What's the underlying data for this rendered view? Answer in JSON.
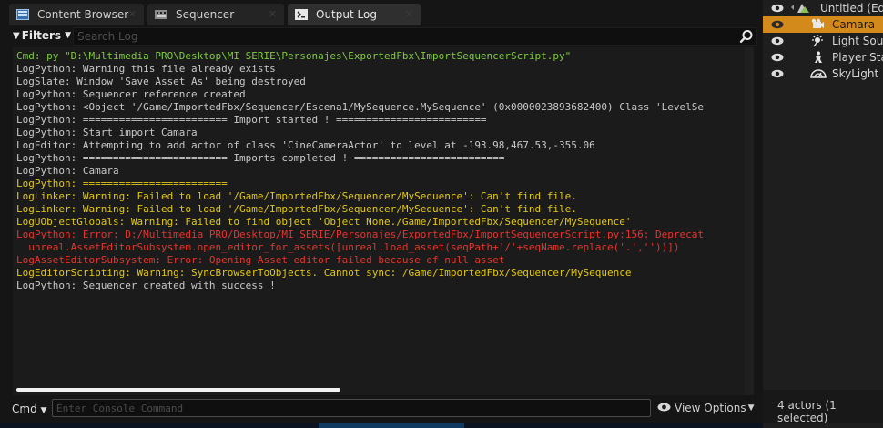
{
  "tabs": [
    {
      "label": "Content Browser",
      "icon": "content-browser-icon",
      "active": false
    },
    {
      "label": "Sequencer",
      "icon": "sequencer-icon",
      "active": false
    },
    {
      "label": "Output Log",
      "icon": "output-log-icon",
      "active": true
    }
  ],
  "toolbar": {
    "filters_label": "Filters",
    "search_placeholder": "Search Log"
  },
  "log_lines": [
    {
      "text": "Cmd: py \"D:\\Multimedia PRO\\Desktop\\MI SERIE\\Personajes\\ExportedFbx\\ImportSequencerScript.py\"",
      "level": "green"
    },
    {
      "text": "LogPython: Warning this file already exists",
      "level": "white"
    },
    {
      "text": "LogSlate: Window 'Save Asset As' being destroyed",
      "level": "white"
    },
    {
      "text": "LogPython: Sequencer reference created",
      "level": "white"
    },
    {
      "text": "LogPython: <Object '/Game/ImportedFbx/Sequencer/Escena1/MySequence.MySequence' (0x0000023893682400) Class 'LevelSe",
      "level": "white"
    },
    {
      "text": "LogPython: ======================== Import started ! =========================",
      "level": "white"
    },
    {
      "text": "LogPython: Start import Camara",
      "level": "white"
    },
    {
      "text": "LogEditor: Attempting to add actor of class 'CineCameraActor' to level at -193.98,467.53,-355.06",
      "level": "white"
    },
    {
      "text": "LogPython: ======================== Imports completed ! =========================",
      "level": "white"
    },
    {
      "text": "LogPython: Camara",
      "level": "white"
    },
    {
      "text": "LogPython: ========================",
      "level": "yellow"
    },
    {
      "text": "LogLinker: Warning: Failed to load '/Game/ImportedFbx/Sequencer/MySequence': Can't find file.",
      "level": "yellow"
    },
    {
      "text": "LogLinker: Warning: Failed to load '/Game/ImportedFbx/Sequencer/MySequence': Can't find file.",
      "level": "yellow"
    },
    {
      "text": "LogUObjectGlobals: Warning: Failed to find object 'Object None./Game/ImportedFbx/Sequencer/MySequence'",
      "level": "yellow"
    },
    {
      "text": "LogPython: Error: D:/Multimedia PRO/Desktop/MI SERIE/Personajes/ExportedFbx/ImportSequencerScript.py:156: Deprecat",
      "level": "red"
    },
    {
      "text": "  unreal.AssetEditorSubsystem.open_editor_for_assets([unreal.load_asset(seqPath+'/'+seqName.replace('.',''))])",
      "level": "red"
    },
    {
      "text": "LogAssetEditorSubsystem: Error: Opening Asset editor failed because of null asset",
      "level": "red"
    },
    {
      "text": "LogEditorScripting: Warning: SyncBrowserToObjects. Cannot sync: /Game/ImportedFbx/Sequencer/MySequence",
      "level": "yellow"
    },
    {
      "text": "LogPython: Sequencer created with success !",
      "level": "white"
    }
  ],
  "cmdbar": {
    "cmd_label": "Cmd",
    "console_placeholder": "Enter Console Command",
    "view_options_label": "View Options"
  },
  "outliner": {
    "items": [
      {
        "label": "Untitled (Edit",
        "icon": "level-icon",
        "selected": false
      },
      {
        "label": "Camara",
        "icon": "camera-actor-icon",
        "selected": true
      },
      {
        "label": "Light Sour",
        "icon": "light-source-icon",
        "selected": false
      },
      {
        "label": "Player Sta",
        "icon": "player-start-icon",
        "selected": false
      },
      {
        "label": "SkyLight",
        "icon": "skylight-icon",
        "selected": false
      }
    ],
    "actors_count": "4 actors (1 selected)"
  },
  "colors": {
    "log_green": "#7ecb3d",
    "log_yellow": "#e2c80f",
    "log_red": "#e6342c",
    "log_white": "#c8c8c8",
    "selection": "#d38a1a"
  }
}
